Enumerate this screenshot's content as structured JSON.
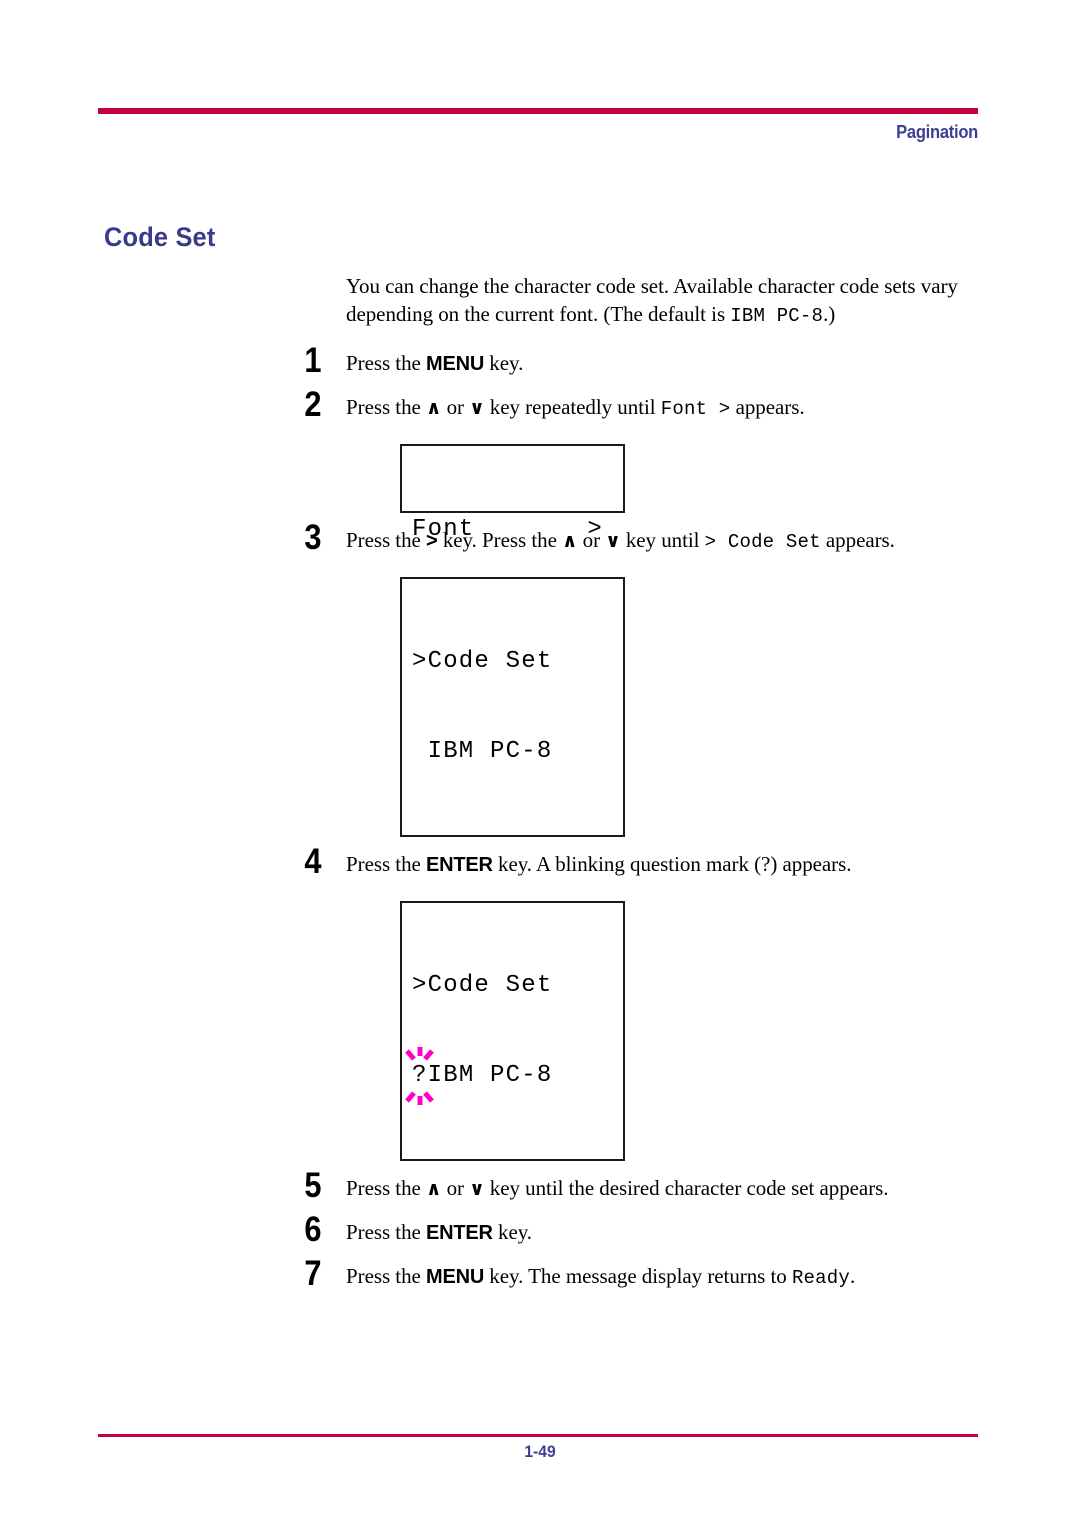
{
  "header": {
    "running_head": "Pagination",
    "rule_color": "#c4003f",
    "text_color": "#3e3e93"
  },
  "heading": {
    "title": "Code Set",
    "color": "#3a3a8c"
  },
  "intro": {
    "line1": "You can change the character code set. Available character code sets vary",
    "line2_before": "depending on the current font. (The default is ",
    "line2_mono": "IBM PC-8",
    "line2_after": ".)"
  },
  "steps": [
    {
      "number": "1",
      "segments": [
        {
          "text": "Press the ",
          "style": "plain"
        },
        {
          "text": "MENU",
          "style": "key"
        },
        {
          "text": " key.",
          "style": "plain"
        }
      ]
    },
    {
      "number": "2",
      "segments": [
        {
          "text": "Press the ",
          "style": "plain"
        },
        {
          "text": "∧",
          "style": "chevron"
        },
        {
          "text": " or ",
          "style": "plain"
        },
        {
          "text": "∨",
          "style": "chevron"
        },
        {
          "text": " key repeatedly until ",
          "style": "plain"
        },
        {
          "text": "Font  ",
          "style": "mono"
        },
        {
          "text": ">",
          "style": "mono"
        },
        {
          "text": " appears.",
          "style": "plain"
        }
      ]
    },
    {
      "number": "3",
      "segments": [
        {
          "text": "Press the ",
          "style": "plain"
        },
        {
          "text": ">",
          "style": "gt"
        },
        {
          "text": " key. Press the ",
          "style": "plain"
        },
        {
          "text": "∧",
          "style": "chevron"
        },
        {
          "text": " or ",
          "style": "plain"
        },
        {
          "text": "∨",
          "style": "chevron"
        },
        {
          "text": " key until ",
          "style": "plain"
        },
        {
          "text": "> ",
          "style": "mono"
        },
        {
          "text": "Code Set",
          "style": "mono"
        },
        {
          "text": " appears.",
          "style": "plain"
        }
      ]
    },
    {
      "number": "4",
      "segments": [
        {
          "text": "Press the ",
          "style": "plain"
        },
        {
          "text": "ENTER",
          "style": "key"
        },
        {
          "text": " key. A blinking question mark (?) appears.",
          "style": "plain"
        }
      ]
    },
    {
      "number": "5",
      "segments": [
        {
          "text": "Press the ",
          "style": "plain"
        },
        {
          "text": "∧",
          "style": "chevron"
        },
        {
          "text": " or ",
          "style": "plain"
        },
        {
          "text": "∨",
          "style": "chevron"
        },
        {
          "text": " key until the desired character code set appears.",
          "style": "plain"
        }
      ]
    },
    {
      "number": "6",
      "segments": [
        {
          "text": "Press the ",
          "style": "plain"
        },
        {
          "text": "ENTER",
          "style": "key"
        },
        {
          "text": " key.",
          "style": "plain"
        }
      ]
    },
    {
      "number": "7",
      "segments": [
        {
          "text": "Press the ",
          "style": "plain"
        },
        {
          "text": "MENU",
          "style": "key"
        },
        {
          "text": " key. The message display returns to ",
          "style": "plain"
        },
        {
          "text": "Ready",
          "style": "mono"
        },
        {
          "text": ".",
          "style": "plain"
        }
      ]
    }
  ],
  "lcd_panels": {
    "font_menu": {
      "line1": "Font",
      "marker": ">",
      "line2": ""
    },
    "code_set": {
      "line1": ">Code Set",
      "line2": " IBM PC-8"
    },
    "code_set_blinking": {
      "line1": ">Code Set",
      "blink_char": "?",
      "line2_rest": "IBM PC-8",
      "blink_color": "#ff00cc"
    }
  },
  "footer": {
    "page_number": "1-49",
    "rule_color": "#c4003f",
    "text_color": "#3e3e93"
  }
}
